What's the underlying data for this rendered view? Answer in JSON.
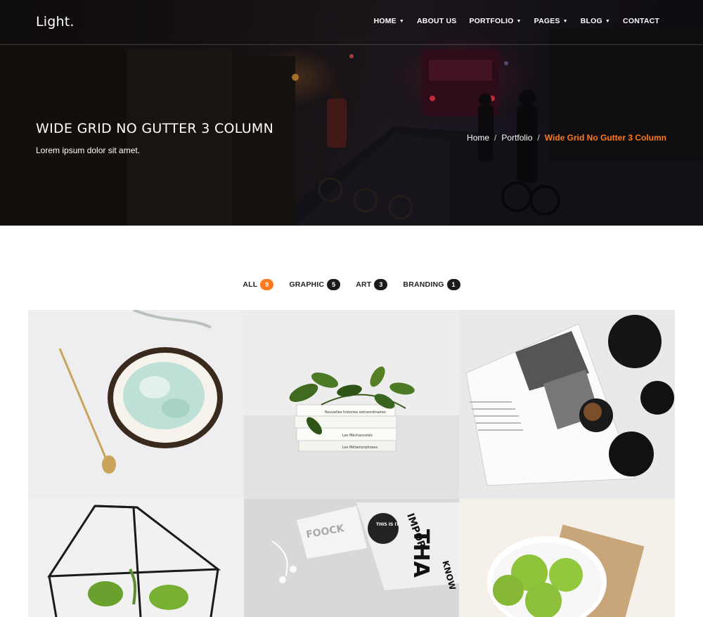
{
  "brand": "Light.",
  "nav": [
    {
      "label": "HOME",
      "dropdown": true
    },
    {
      "label": "ABOUT US",
      "dropdown": false
    },
    {
      "label": "PORTFOLIO",
      "dropdown": true
    },
    {
      "label": "PAGES",
      "dropdown": true
    },
    {
      "label": "BLOG",
      "dropdown": true
    },
    {
      "label": "CONTACT",
      "dropdown": false
    }
  ],
  "hero": {
    "title": "WIDE GRID NO GUTTER 3 COLUMN",
    "subtitle": "Lorem ipsum dolor sit amet."
  },
  "breadcrumb": {
    "home": "Home",
    "portfolio": "Portfolio",
    "current": "Wide Grid No Gutter 3 Column",
    "separator": "/"
  },
  "filters": [
    {
      "label": "ALL",
      "count": "9",
      "active": true
    },
    {
      "label": "GRAPHIC",
      "count": "5",
      "active": false
    },
    {
      "label": "ART",
      "count": "3",
      "active": false
    },
    {
      "label": "BRANDING",
      "count": "1",
      "active": false
    }
  ],
  "colors": {
    "accent": "#ff7a1a",
    "badge": "#1b1b1b"
  },
  "book_spines": [
    "Nouvelles histoires extraordinaires",
    "Les Méchancetés",
    "Les Métamorphoses"
  ],
  "poster_texts": [
    "THIS IS IT",
    "THA",
    "KNOW",
    "IMPOR"
  ]
}
